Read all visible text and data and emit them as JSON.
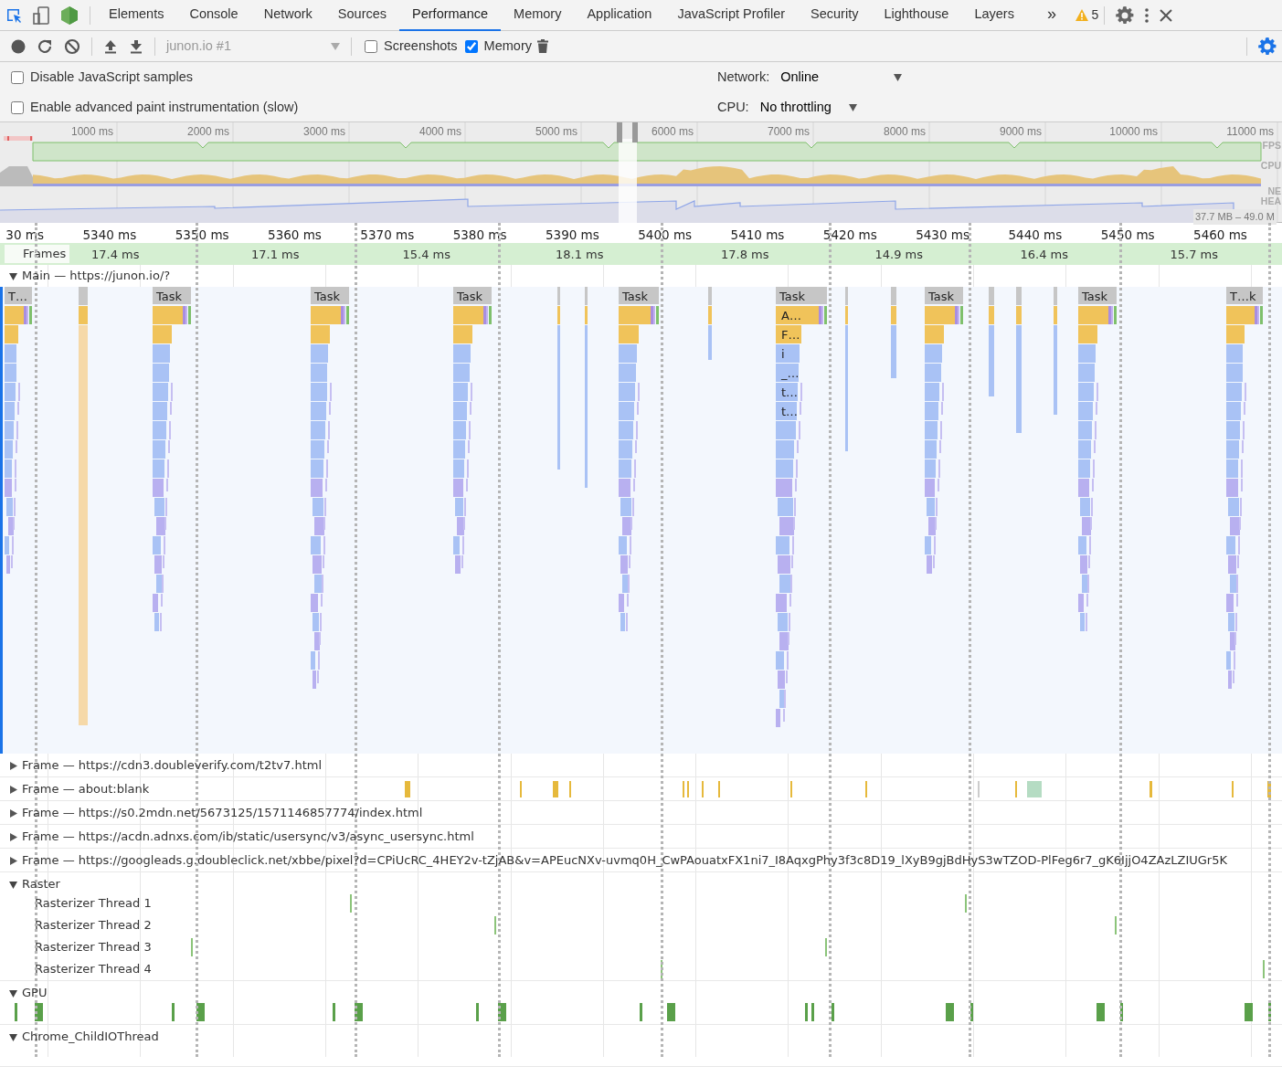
{
  "tabs_bar": {
    "tabs": [
      {
        "label": "Elements",
        "selected": false
      },
      {
        "label": "Console",
        "selected": false
      },
      {
        "label": "Network",
        "selected": false
      },
      {
        "label": "Sources",
        "selected": false
      },
      {
        "label": "Performance",
        "selected": true
      },
      {
        "label": "Memory",
        "selected": false
      },
      {
        "label": "Application",
        "selected": false
      },
      {
        "label": "JavaScript Profiler",
        "selected": false
      },
      {
        "label": "Security",
        "selected": false
      },
      {
        "label": "Lighthouse",
        "selected": false
      },
      {
        "label": "Layers",
        "selected": false
      }
    ],
    "overflow": "»",
    "warning_count": "5"
  },
  "toolbar": {
    "profile": "junon.io #1",
    "checkboxes": [
      {
        "label": "Screenshots",
        "checked": false
      },
      {
        "label": "Memory",
        "checked": true
      }
    ]
  },
  "settings": {
    "options": [
      {
        "label": "Disable JavaScript samples",
        "checked": false
      },
      {
        "label": "Enable advanced paint instrumentation (slow)",
        "checked": false
      }
    ],
    "network": {
      "label": "Network:",
      "value": "Online"
    },
    "cpu": {
      "label": "CPU:",
      "value": "No throttling"
    }
  },
  "overview": {
    "ticks": [
      "1000 ms",
      "2000 ms",
      "3000 ms",
      "4000 ms",
      "5000 ms",
      "6000 ms",
      "7000 ms",
      "8000 ms",
      "9000 ms",
      "10000 ms",
      "11000 ms"
    ],
    "track_labels": [
      "FPS",
      "CPU",
      "NE",
      "HEA"
    ],
    "heap_range": "37.7 MB – 49.0 M"
  },
  "timeline": {
    "ticks": [
      "30 ms",
      "5340 ms",
      "5350 ms",
      "5360 ms",
      "5370 ms",
      "5380 ms",
      "5390 ms",
      "5400 ms",
      "5410 ms",
      "5420 ms",
      "5430 ms",
      "5440 ms",
      "5450 ms",
      "5460 ms"
    ],
    "frames": {
      "label": "Frames",
      "durations": [
        "17.4 ms",
        "17.1 ms",
        "15.4 ms",
        "18.1 ms",
        "17.8 ms",
        "14.9 ms",
        "16.4 ms",
        "15.7 ms"
      ]
    },
    "main": {
      "title": "Main — https://junon.io/?",
      "expanded": true,
      "tasks": [
        {
          "label": "T…"
        },
        {
          "label": "Task"
        },
        {
          "label": "Task"
        },
        {
          "label": "Task"
        },
        {
          "label": "Task"
        },
        {
          "label": "Task",
          "calls": [
            "A…",
            "F…",
            "i",
            "_…",
            "t…",
            "t…"
          ]
        },
        {
          "label": "Task"
        },
        {
          "label": "Task"
        },
        {
          "label": "T…k"
        }
      ]
    },
    "tracks": [
      {
        "title": "Frame — https://cdn3.doubleverify.com/t2tv7.html",
        "expanded": false
      },
      {
        "title": "Frame — about:blank",
        "expanded": false
      },
      {
        "title": "Frame — https://s0.2mdn.net/5673125/1571146857774/index.html",
        "expanded": false
      },
      {
        "title": "Frame — https://acdn.adnxs.com/ib/static/usersync/v3/async_usersync.html",
        "expanded": false
      },
      {
        "title": "Frame — https://googleads.g.doubleclick.net/xbbe/pixel?d=CPiUcRC_4HEY2v-tZjAB&v=APEucNXv-uvmq0H_CwPAouatxFX1ni7_I8AqxgPhy3f3c8D19_lXyB9gjBdHyS3wTZOD-PlFeg6r7_gK6IjjO4ZAzLZIUGr5K",
        "expanded": false
      },
      {
        "title": "Raster",
        "expanded": true,
        "children": [
          {
            "title": "Rasterizer Thread 1"
          },
          {
            "title": "Rasterizer Thread 2"
          },
          {
            "title": "Rasterizer Thread 3"
          },
          {
            "title": "Rasterizer Thread 4"
          }
        ]
      },
      {
        "title": "GPU",
        "expanded": true
      },
      {
        "title": "Chrome_ChildIOThread",
        "expanded": true
      }
    ]
  }
}
